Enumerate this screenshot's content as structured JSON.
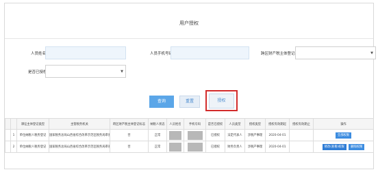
{
  "header": {
    "title": "用户授权"
  },
  "form": {
    "name_label": "人员姓名",
    "name_value": "",
    "phone_label": "人员手机号码",
    "phone_value": "",
    "category_label": "跨区财产税主体登记标志",
    "category_value": "",
    "authorized_label": "是否已授权",
    "authorized_value": ""
  },
  "buttons": {
    "query": "查询",
    "reset": "重置",
    "authorize": "授权"
  },
  "table": {
    "headers": [
      "",
      "",
      "课征主体登记类型",
      "主管税务机关",
      "跨区财产税主体登记标志",
      "纳税人状态",
      "人员姓名",
      "手机号码",
      "是否已授权",
      "人员类型",
      "授权类型",
      "授权有效期起",
      "授权有效期止",
      "操作"
    ],
    "rows": [
      {
        "index": "1",
        "type": "单位纳税人税务登记",
        "authority": "国家税务总局山西省综合改革示范区税务局审查",
        "cross": "否",
        "status": "正常",
        "auth": "已授权",
        "person_type": "法定代表人",
        "auth_type": "涉税产事理",
        "start": "2020-04-01",
        "end": "",
        "ops": [
          "全部权限"
        ]
      },
      {
        "index": "2",
        "type": "单位纳税人税务登记",
        "authority": "国家税务总局山西省综合改革示范区税务局审查",
        "cross": "否",
        "status": "正常",
        "auth": "已授权",
        "person_type": "财务负责人",
        "auth_type": "涉税产事理",
        "start": "2020-04-01",
        "end": "",
        "ops": [
          "修改(查看)权限",
          "删除权限"
        ]
      }
    ]
  }
}
